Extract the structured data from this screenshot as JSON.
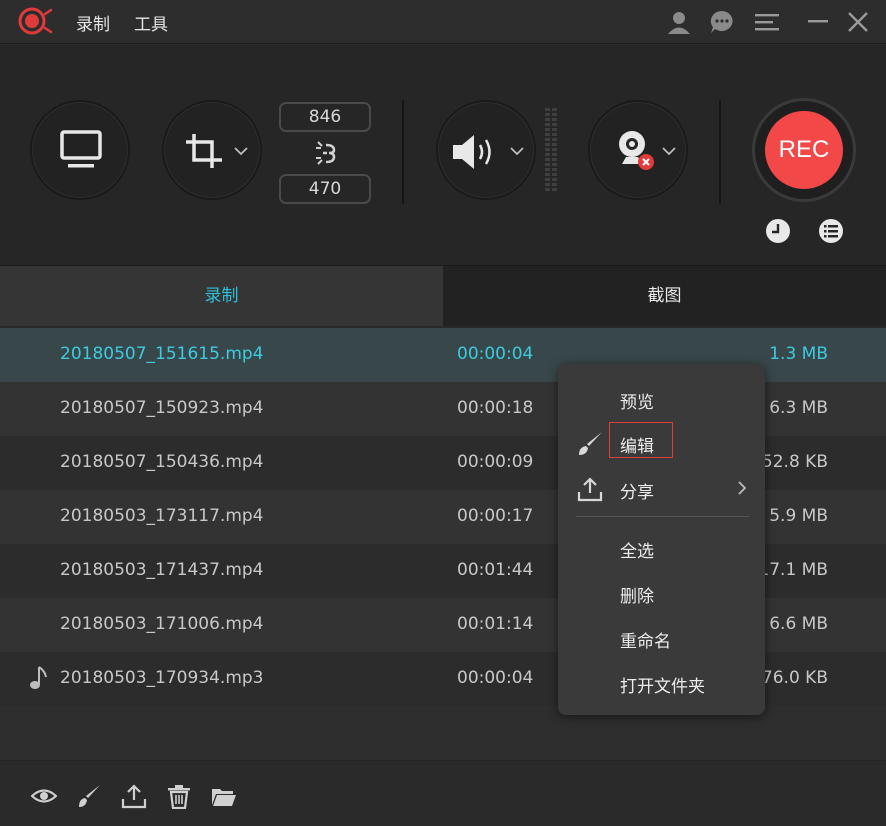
{
  "titlebar": {
    "menu": [
      "录制",
      "工具"
    ],
    "icons": [
      "user-icon",
      "chat-icon",
      "menu-icon",
      "minimize-icon",
      "close-icon"
    ]
  },
  "toolbar": {
    "width_value": "846",
    "height_value": "470",
    "rec_label": "REC"
  },
  "tabs": {
    "record": "录制",
    "screenshot": "截图"
  },
  "files": [
    {
      "name": "20180507_151615.mp4",
      "duration": "00:00:04",
      "size": "1.3 MB",
      "selected": true,
      "audio": false
    },
    {
      "name": "20180507_150923.mp4",
      "duration": "00:00:18",
      "size": "6.3 MB",
      "selected": false,
      "audio": false
    },
    {
      "name": "20180507_150436.mp4",
      "duration": "00:00:09",
      "size": "52.8 KB",
      "selected": false,
      "audio": false
    },
    {
      "name": "20180503_173117.mp4",
      "duration": "00:00:17",
      "size": "5.9 MB",
      "selected": false,
      "audio": false
    },
    {
      "name": "20180503_171437.mp4",
      "duration": "00:01:44",
      "size": "17.1 MB",
      "selected": false,
      "audio": false
    },
    {
      "name": "20180503_171006.mp4",
      "duration": "00:01:14",
      "size": "6.6 MB",
      "selected": false,
      "audio": false
    },
    {
      "name": "20180503_170934.mp3",
      "duration": "00:00:04",
      "size": "476.0 KB",
      "selected": false,
      "audio": true
    }
  ],
  "context_menu": {
    "preview": "预览",
    "edit": "编辑",
    "share": "分享",
    "select_all": "全选",
    "delete": "删除",
    "rename": "重命名",
    "open_folder": "打开文件夹"
  },
  "colors": {
    "accent": "#3ccbe0",
    "rec": "#f24848",
    "highlight": "#e23b3b"
  }
}
